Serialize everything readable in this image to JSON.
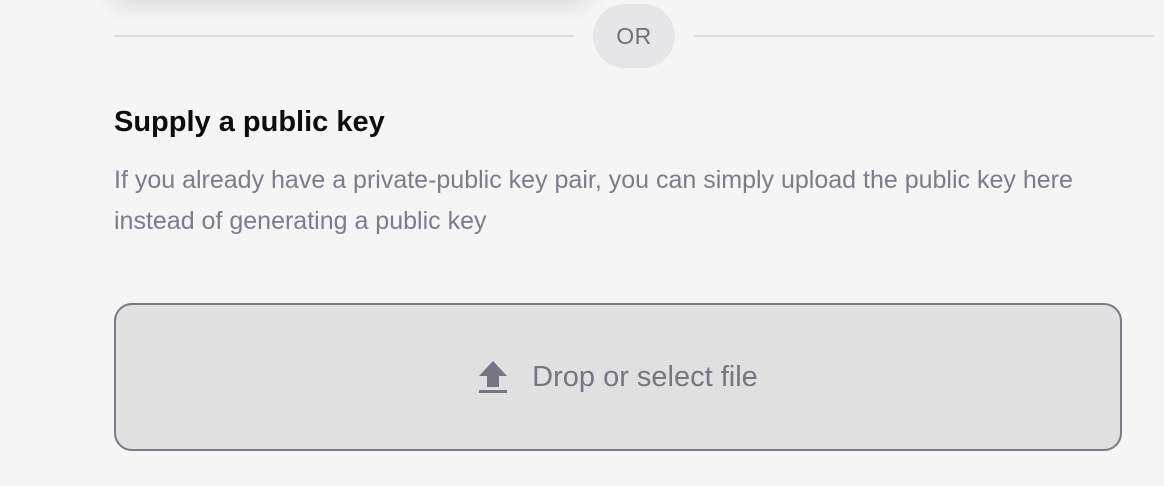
{
  "divider": {
    "label": "OR"
  },
  "supply_key": {
    "title": "Supply a public key",
    "description": "If you already have a private-public key pair, you can simply upload the public key here instead of generating a public key"
  },
  "dropzone": {
    "label": "Drop or select file",
    "icon": "upload-icon"
  },
  "colors": {
    "background": "#f5f5f5",
    "dropzone_bg": "#e0e0e1",
    "dropzone_border": "#7a7a86",
    "muted_text": "#7c7c8a",
    "heading_text": "#0d0d0d"
  }
}
